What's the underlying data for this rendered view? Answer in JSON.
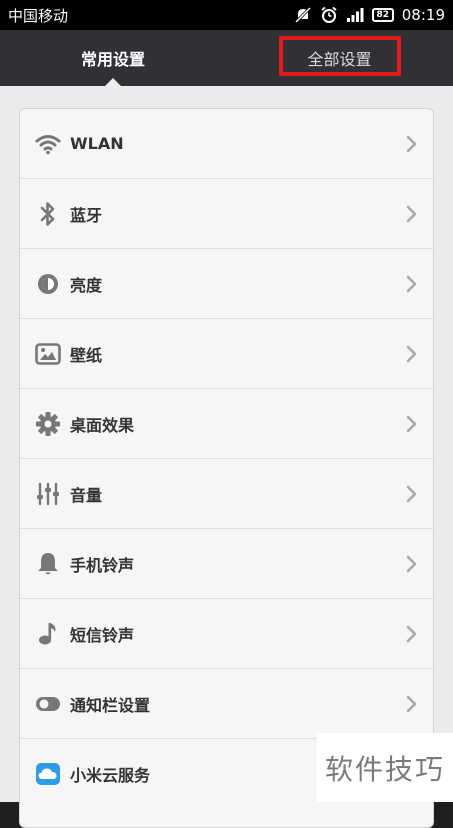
{
  "status_bar": {
    "carrier": "中国移动",
    "battery": "82",
    "time": "08:19"
  },
  "tabs": {
    "common_label": "常用设置",
    "all_label": "全部设置"
  },
  "settings": {
    "items": [
      {
        "label": "WLAN",
        "icon": "wifi-icon"
      },
      {
        "label": "蓝牙",
        "icon": "bluetooth-icon"
      },
      {
        "label": "亮度",
        "icon": "brightness-icon"
      },
      {
        "label": "壁纸",
        "icon": "wallpaper-icon"
      },
      {
        "label": "桌面效果",
        "icon": "gear-icon"
      },
      {
        "label": "音量",
        "icon": "volume-sliders-icon"
      },
      {
        "label": "手机铃声",
        "icon": "bell-icon"
      },
      {
        "label": "短信铃声",
        "icon": "music-note-icon"
      },
      {
        "label": "通知栏设置",
        "icon": "toggle-icon"
      },
      {
        "label": "小米云服务",
        "icon": "cloud-icon"
      }
    ]
  },
  "colors": {
    "highlight_box": "#e21b1b",
    "header_bg": "#303035",
    "cloud_icon": "#2f9de6"
  },
  "watermark": {
    "text": "软件技巧"
  }
}
